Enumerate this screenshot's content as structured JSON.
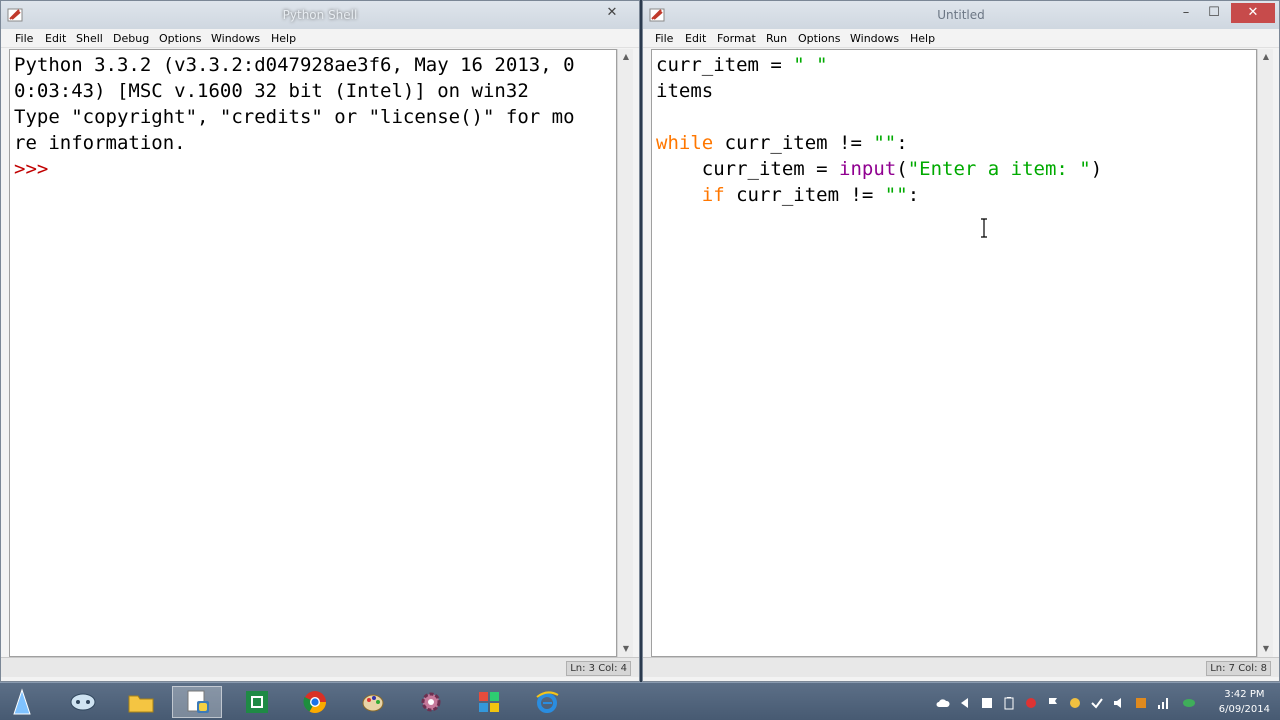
{
  "shell": {
    "title": "Python Shell",
    "menu": [
      "File",
      "Edit",
      "Shell",
      "Debug",
      "Options",
      "Windows",
      "Help"
    ],
    "lines": [
      "Python 3.3.2 (v3.3.2:d047928ae3f6, May 16 2013, 0",
      "0:03:43) [MSC v.1600 32 bit (Intel)] on win32",
      "Type \"copyright\", \"credits\" or \"license()\" for mo",
      "re information."
    ],
    "prompt": ">>>",
    "status": "Ln: 3 Col: 4"
  },
  "editor": {
    "title": "Untitled",
    "menu": [
      "File",
      "Edit",
      "Format",
      "Run",
      "Options",
      "Windows",
      "Help"
    ],
    "code": {
      "l1_var": "curr_item = ",
      "l1_str": "\" \"",
      "l2": "items",
      "l4_kw": "while",
      "l4_rest": " curr_item != ",
      "l4_str": "\"\"",
      "l4_end": ":",
      "l5_a": "    curr_item = ",
      "l5_bi": "input",
      "l5_p": "(",
      "l5_str": "\"Enter a item: \"",
      "l5_end": ")",
      "l6_kw": "    if",
      "l6_rest": " curr_item != ",
      "l6_str": "\"\"",
      "l6_end": ":"
    },
    "status": "Ln: 7 Col: 8"
  },
  "taskbar": {
    "clock_time": "3:42 PM",
    "clock_date": "6/09/2014"
  },
  "colors": {
    "keyword": "#ff7700",
    "string": "#00aa00",
    "builtin": "#900090",
    "prompt": "#c00000"
  }
}
